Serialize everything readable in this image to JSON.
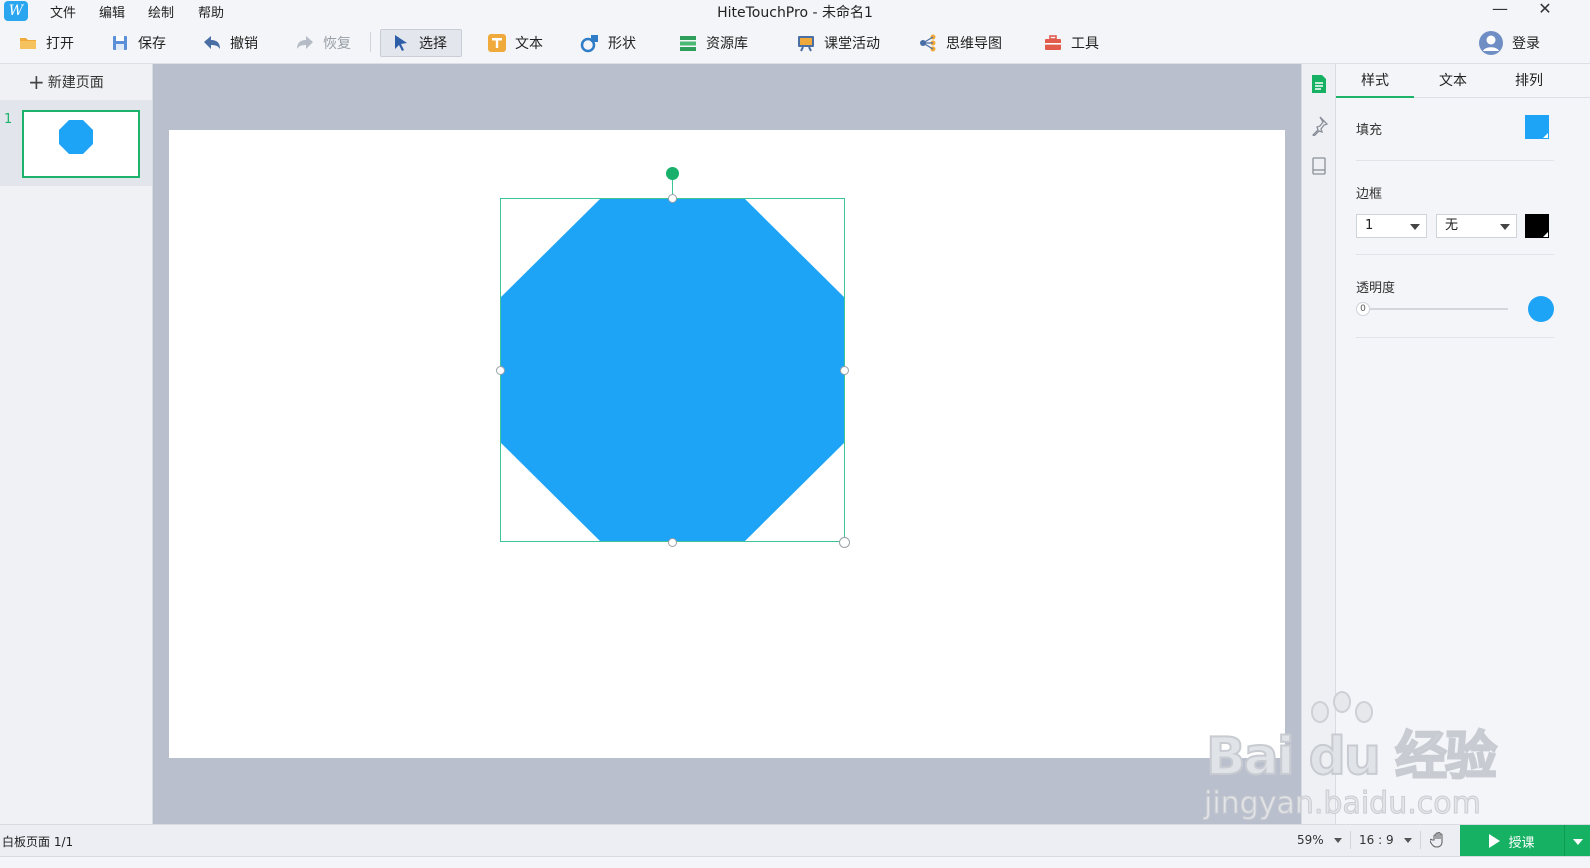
{
  "app": {
    "logo_text": "W",
    "window_title": "HiteTouchPro - 未命名1"
  },
  "menu": [
    "文件",
    "编辑",
    "绘制",
    "帮助"
  ],
  "toolbar": {
    "open": "打开",
    "save": "保存",
    "undo": "撤销",
    "redo": "恢复",
    "select": "选择",
    "text": "文本",
    "shape": "形状",
    "resources": "资源库",
    "activity": "课堂活动",
    "mindmap": "思维导图",
    "tools": "工具",
    "login": "登录"
  },
  "pages_panel": {
    "new_page": "新建页面",
    "pages": [
      {
        "number": "1"
      }
    ]
  },
  "canvas": {
    "shape_type": "octagon",
    "shape_fill": "#1ea4f7",
    "selection_color": "#3fc493",
    "rotate_handle_color": "#18b06a"
  },
  "properties": {
    "tabs": [
      "样式",
      "文本",
      "排列"
    ],
    "active_tab": "样式",
    "fill_label": "填充",
    "fill_color": "#1ea4f7",
    "border_label": "边框",
    "border_width": "1",
    "border_style": "无",
    "border_color": "#000000",
    "opacity_label": "透明度",
    "opacity_min": "0"
  },
  "status": {
    "page_info": "白板页面 1/1",
    "zoom": "59%",
    "aspect": "16 : 9",
    "lesson_button": "授课"
  },
  "watermark": {
    "main": "Bai du 经验",
    "sub": "jingyan.baidu.com"
  },
  "icons": [
    "folder-icon",
    "save-icon",
    "undo-icon",
    "redo-icon",
    "cursor-icon",
    "text-icon",
    "shape-icon",
    "resources-icon",
    "activity-icon",
    "mindmap-icon",
    "toolbox-icon",
    "user-icon",
    "minimize-icon",
    "close-icon",
    "properties-icon",
    "pin-icon",
    "book-icon",
    "hand-icon",
    "play-icon"
  ]
}
